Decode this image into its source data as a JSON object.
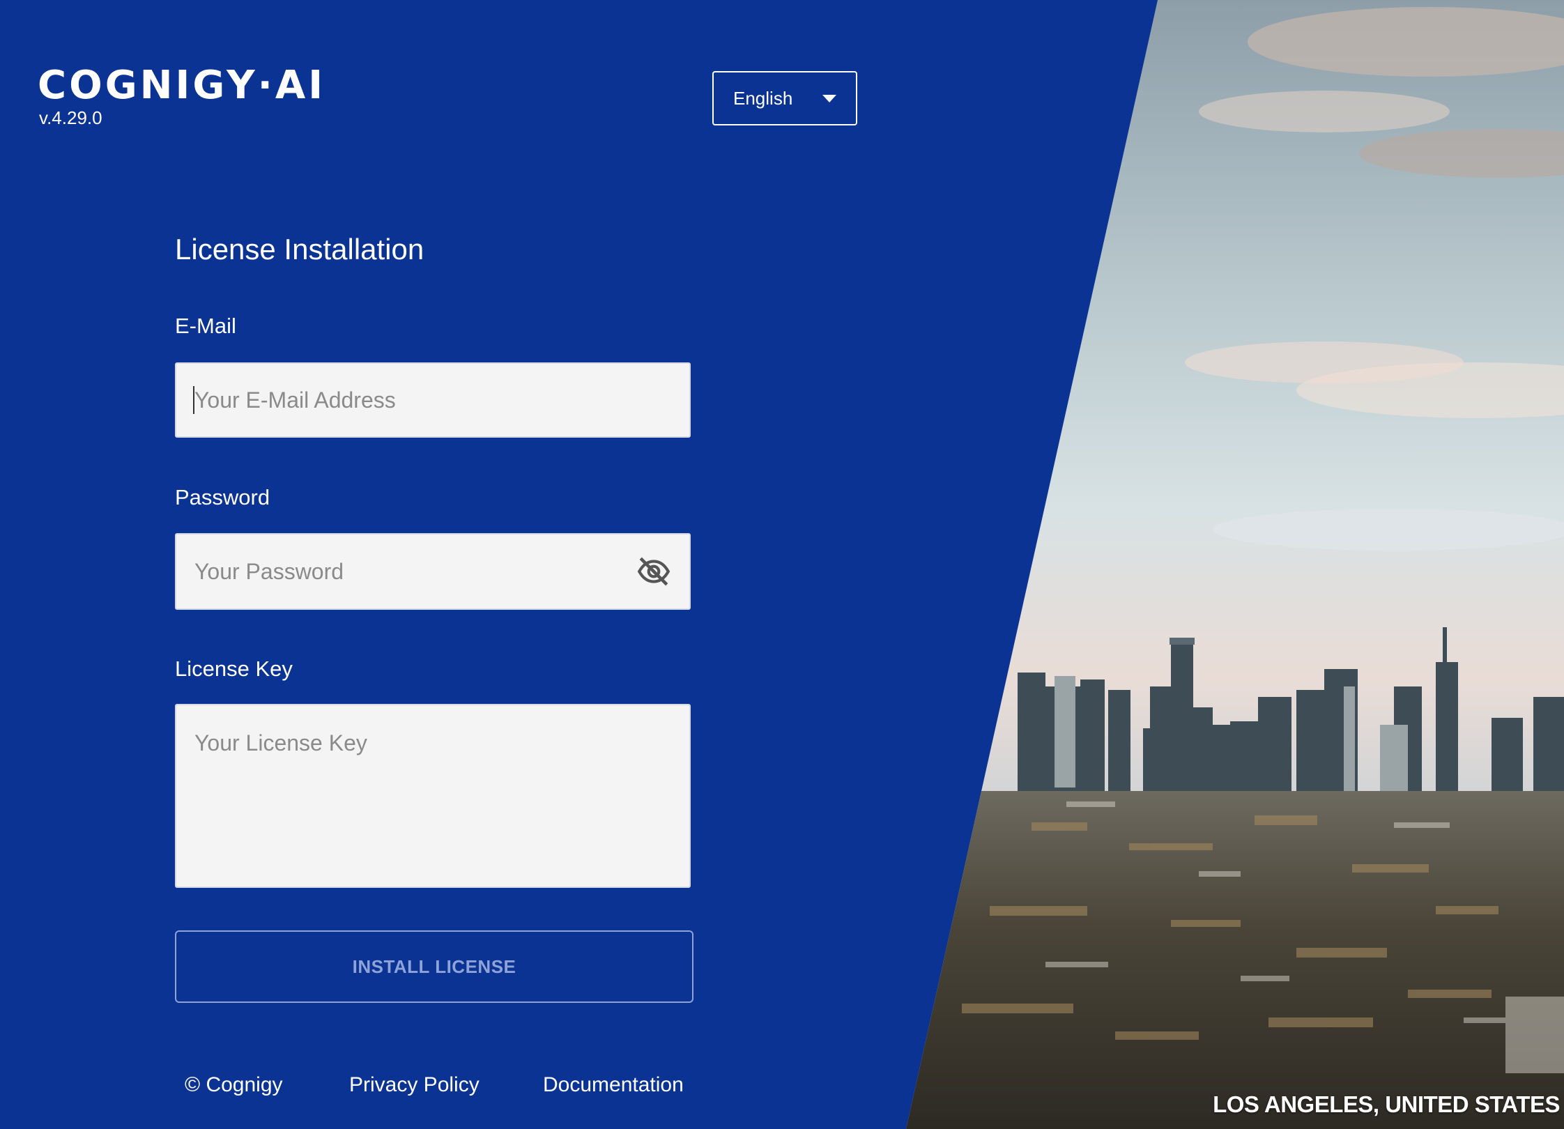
{
  "brand": {
    "logo_text": "COGNIGY·AI",
    "version": "v.4.29.0"
  },
  "language_select": {
    "value": "English",
    "icon": "chevron-down-icon"
  },
  "form": {
    "title": "License Installation",
    "email": {
      "label": "E-Mail",
      "placeholder": "Your E-Mail Address",
      "value": ""
    },
    "password": {
      "label": "Password",
      "placeholder": "Your Password",
      "value": "",
      "toggle_icon": "eye-slash-icon"
    },
    "license_key": {
      "label": "License Key",
      "placeholder": "Your License Key",
      "value": ""
    },
    "submit_label": "INSTALL LICENSE"
  },
  "footer": {
    "copyright": "© Cognigy",
    "privacy": "Privacy Policy",
    "docs": "Documentation"
  },
  "background_image": {
    "caption": "LOS ANGELES, UNITED STATES"
  },
  "colors": {
    "panel_bg": "#0b3394",
    "field_bg": "#f4f4f4",
    "button_text_disabled": "#8ea3d8"
  }
}
